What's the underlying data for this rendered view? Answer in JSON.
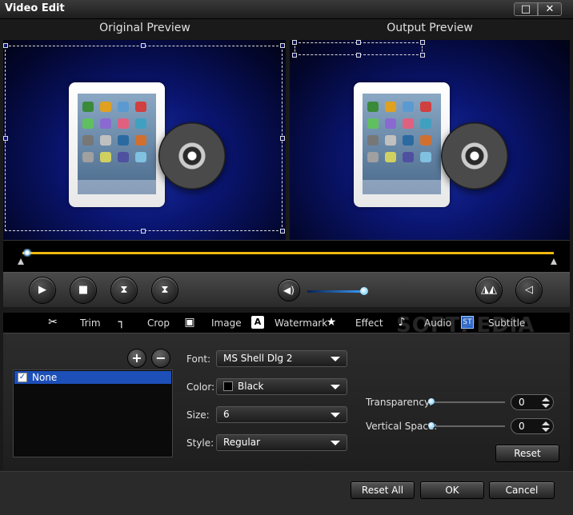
{
  "window": {
    "title": "Video Edit",
    "maximize_icon": "□",
    "close_icon": "✕"
  },
  "preview": {
    "original_label": "Original Preview",
    "output_label": "Output Preview"
  },
  "controls": {
    "play_icon": "▶",
    "stop_icon": "■",
    "prev_icon": "⧗",
    "next_icon": "⧗",
    "volume_icon": "◀)",
    "volume_level": 0.82,
    "flip_h_icon": "◮◭",
    "flip_v_icon": "◁"
  },
  "tabs": [
    {
      "label": "Trim",
      "icon": "✂"
    },
    {
      "label": "Crop",
      "icon": "┐"
    },
    {
      "label": "Image",
      "icon": "▣"
    },
    {
      "label": "Watermark",
      "icon": "A"
    },
    {
      "label": "Effect",
      "icon": "★"
    },
    {
      "label": "Audio",
      "icon": "♪"
    },
    {
      "label": "Subtitle",
      "icon": "ST"
    }
  ],
  "active_tab": "Subtitle",
  "watermark_text": "SOFTPEDIA",
  "subtitle": {
    "add_icon": "+",
    "remove_icon": "−",
    "items": [
      {
        "label": "None",
        "checked": true,
        "check_mark": "✓"
      }
    ],
    "font_label": "Font:",
    "font_value": "MS Shell Dlg 2",
    "color_label": "Color:",
    "color_value": "Black",
    "color_swatch": "#000000",
    "size_label": "Size:",
    "size_value": "6",
    "style_label": "Style:",
    "style_value": "Regular",
    "transparency_label": "Transparency:",
    "transparency_value": "0",
    "vertical_space_label": "Vertical Space:",
    "vertical_space_value": "0",
    "reset_label": "Reset"
  },
  "footer": {
    "reset_all_label": "Reset All",
    "ok_label": "OK",
    "cancel_label": "Cancel"
  }
}
